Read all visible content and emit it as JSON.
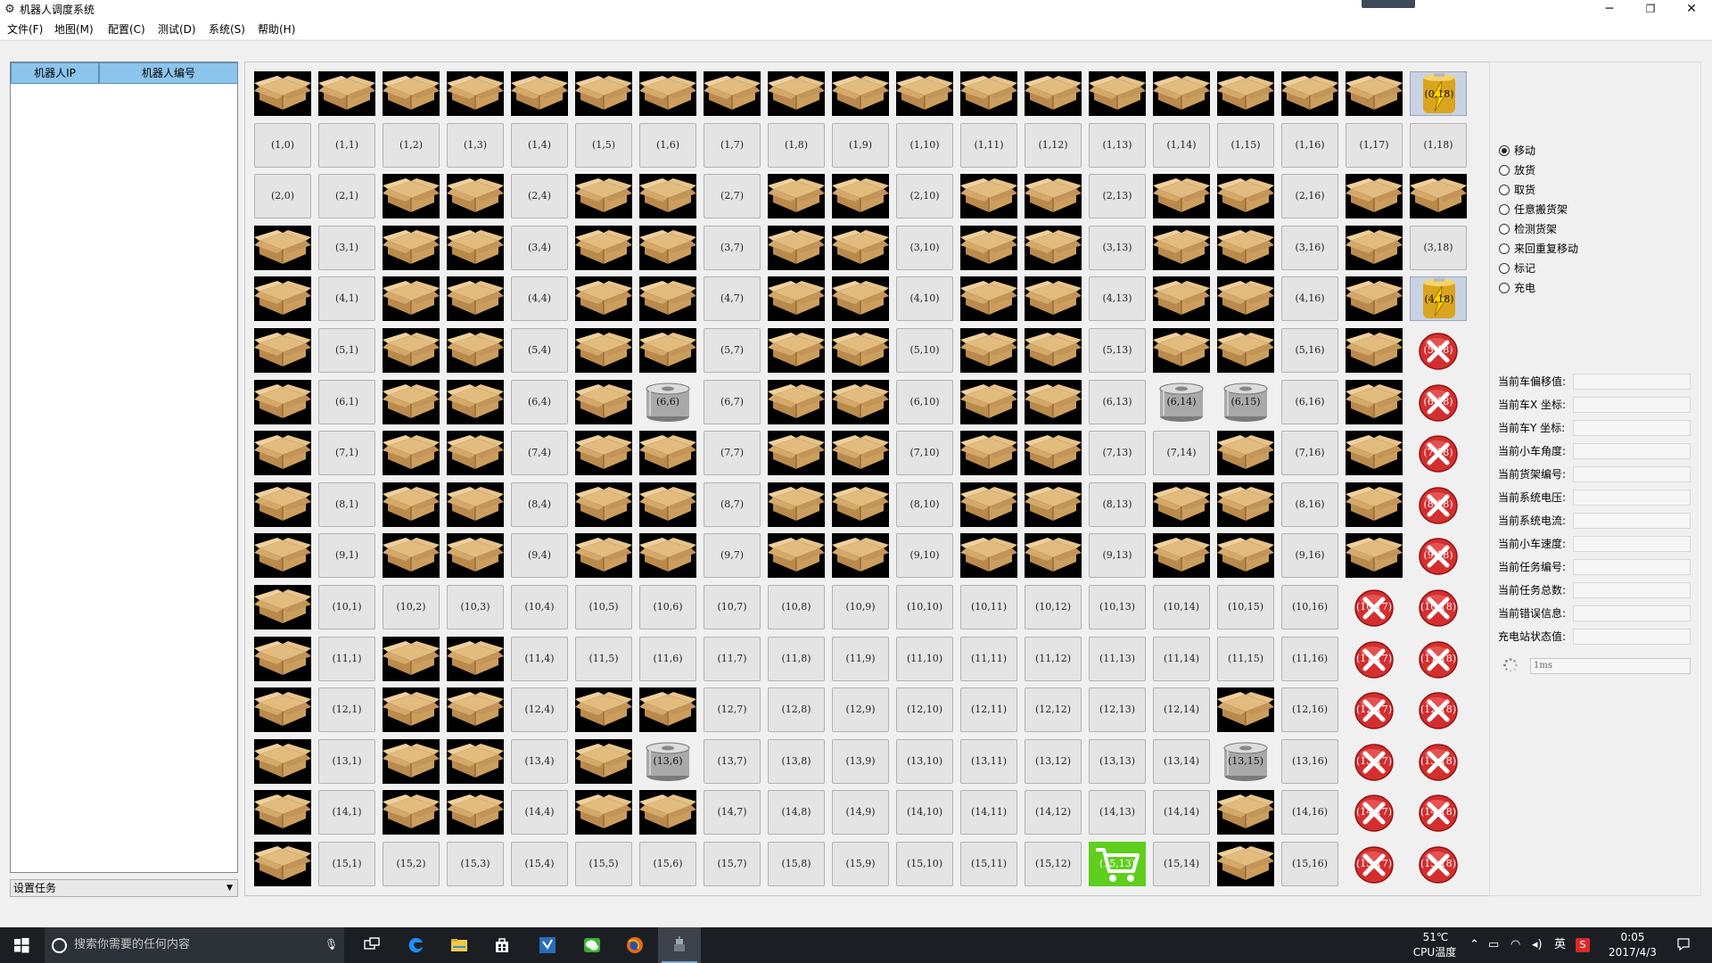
{
  "window": {
    "title": "机器人调度系统",
    "app_icon": "robot-icon",
    "controls": {
      "minimize": "─",
      "maximize": "❐",
      "close": "✕"
    }
  },
  "menu": [
    {
      "label": "文件(F)"
    },
    {
      "label": "地图(M)"
    },
    {
      "label": "配置(C)"
    },
    {
      "label": "测试(D)"
    },
    {
      "label": "系统(S)"
    },
    {
      "label": "帮助(H)"
    }
  ],
  "robot_table": {
    "col_ip": "机器人IP",
    "col_id": "机器人编号",
    "rows": []
  },
  "task_select": {
    "value": "设置任务"
  },
  "grid": {
    "rows": 16,
    "cols": 19,
    "legend": {
      "E": "empty",
      "B": "box",
      "C": "charger",
      "R": "reel",
      "X": "blocked",
      "S": "cart"
    },
    "layout": [
      "BBBBBBBBBBBBBBBBBBC",
      "EEEEEEEEEEEEEEEEEEE",
      "EEBBEBBEBBEBBEBBEBB",
      "BEBBEBBEBBEBBEBBEBE",
      "BEBBEBBEBBEBBEBBEBC",
      "BEBBEBBEBBEBBEBBEBX",
      "BEBBEBREBBEBBERREBX",
      "BEBBEBBEBBEBBEEBEBX",
      "BEBBEBBEBBEBBEBBEBX",
      "BEBBEBBEBBEBBEBBEBX",
      "BEEEEEEEEEEEEEEEEXX",
      "BEBBEEEEEEEEEEEEEXX",
      "BEBBEBBEEEEEEEEBEXX",
      "BEBBEBREEEEEEEEREXX",
      "BEBBEBBEEEEEEEEBEXX",
      "BEEEEEEEEEEEESEBEXX"
    ],
    "cell_label_format": "({r},{c})"
  },
  "right_panel": {
    "modes": [
      {
        "label": "移动",
        "checked": true
      },
      {
        "label": "放货",
        "checked": false
      },
      {
        "label": "取货",
        "checked": false
      },
      {
        "label": "任意搬货架",
        "checked": false
      },
      {
        "label": "检测货架",
        "checked": false
      },
      {
        "label": "来回重复移动",
        "checked": false
      },
      {
        "label": "标记",
        "checked": false
      },
      {
        "label": "充电",
        "checked": false
      }
    ],
    "fields": [
      {
        "label": "当前车偏移值:",
        "value": ""
      },
      {
        "label": "当前车X 坐标:",
        "value": ""
      },
      {
        "label": "当前车Y 坐标:",
        "value": ""
      },
      {
        "label": "当前小车角度:",
        "value": ""
      },
      {
        "label": "当前货架编号:",
        "value": ""
      },
      {
        "label": "当前系统电压:",
        "value": ""
      },
      {
        "label": "当前系统电流:",
        "value": ""
      },
      {
        "label": "当前小车速度:",
        "value": ""
      },
      {
        "label": "当前任务编号:",
        "value": ""
      },
      {
        "label": "当前任务总数:",
        "value": ""
      },
      {
        "label": "当前错误信息:",
        "value": ""
      },
      {
        "label": "充电站状态值:",
        "value": ""
      }
    ],
    "interval": "1ms"
  },
  "taskbar": {
    "search_placeholder": "搜索你需要的任何内容",
    "apps": [
      {
        "name": "task-view-icon"
      },
      {
        "name": "edge-icon"
      },
      {
        "name": "file-explorer-icon"
      },
      {
        "name": "store-icon"
      },
      {
        "name": "visual-studio-icon"
      },
      {
        "name": "wechat-icon"
      },
      {
        "name": "firefox-icon"
      },
      {
        "name": "robot-app-icon",
        "active": true
      }
    ],
    "temperature": "51℃",
    "temperature_label": "CPU温度",
    "ime": "英",
    "time": "0:05",
    "date": "2017/4/3"
  },
  "colors": {
    "header_blue": "#8dc4ec",
    "empty_cell": "#e4e4e4",
    "box_bg": "#000000",
    "blocked_red": "#d42e2e",
    "cart_green": "#5ecf1c",
    "charger_bg": "#c9d2e3"
  }
}
